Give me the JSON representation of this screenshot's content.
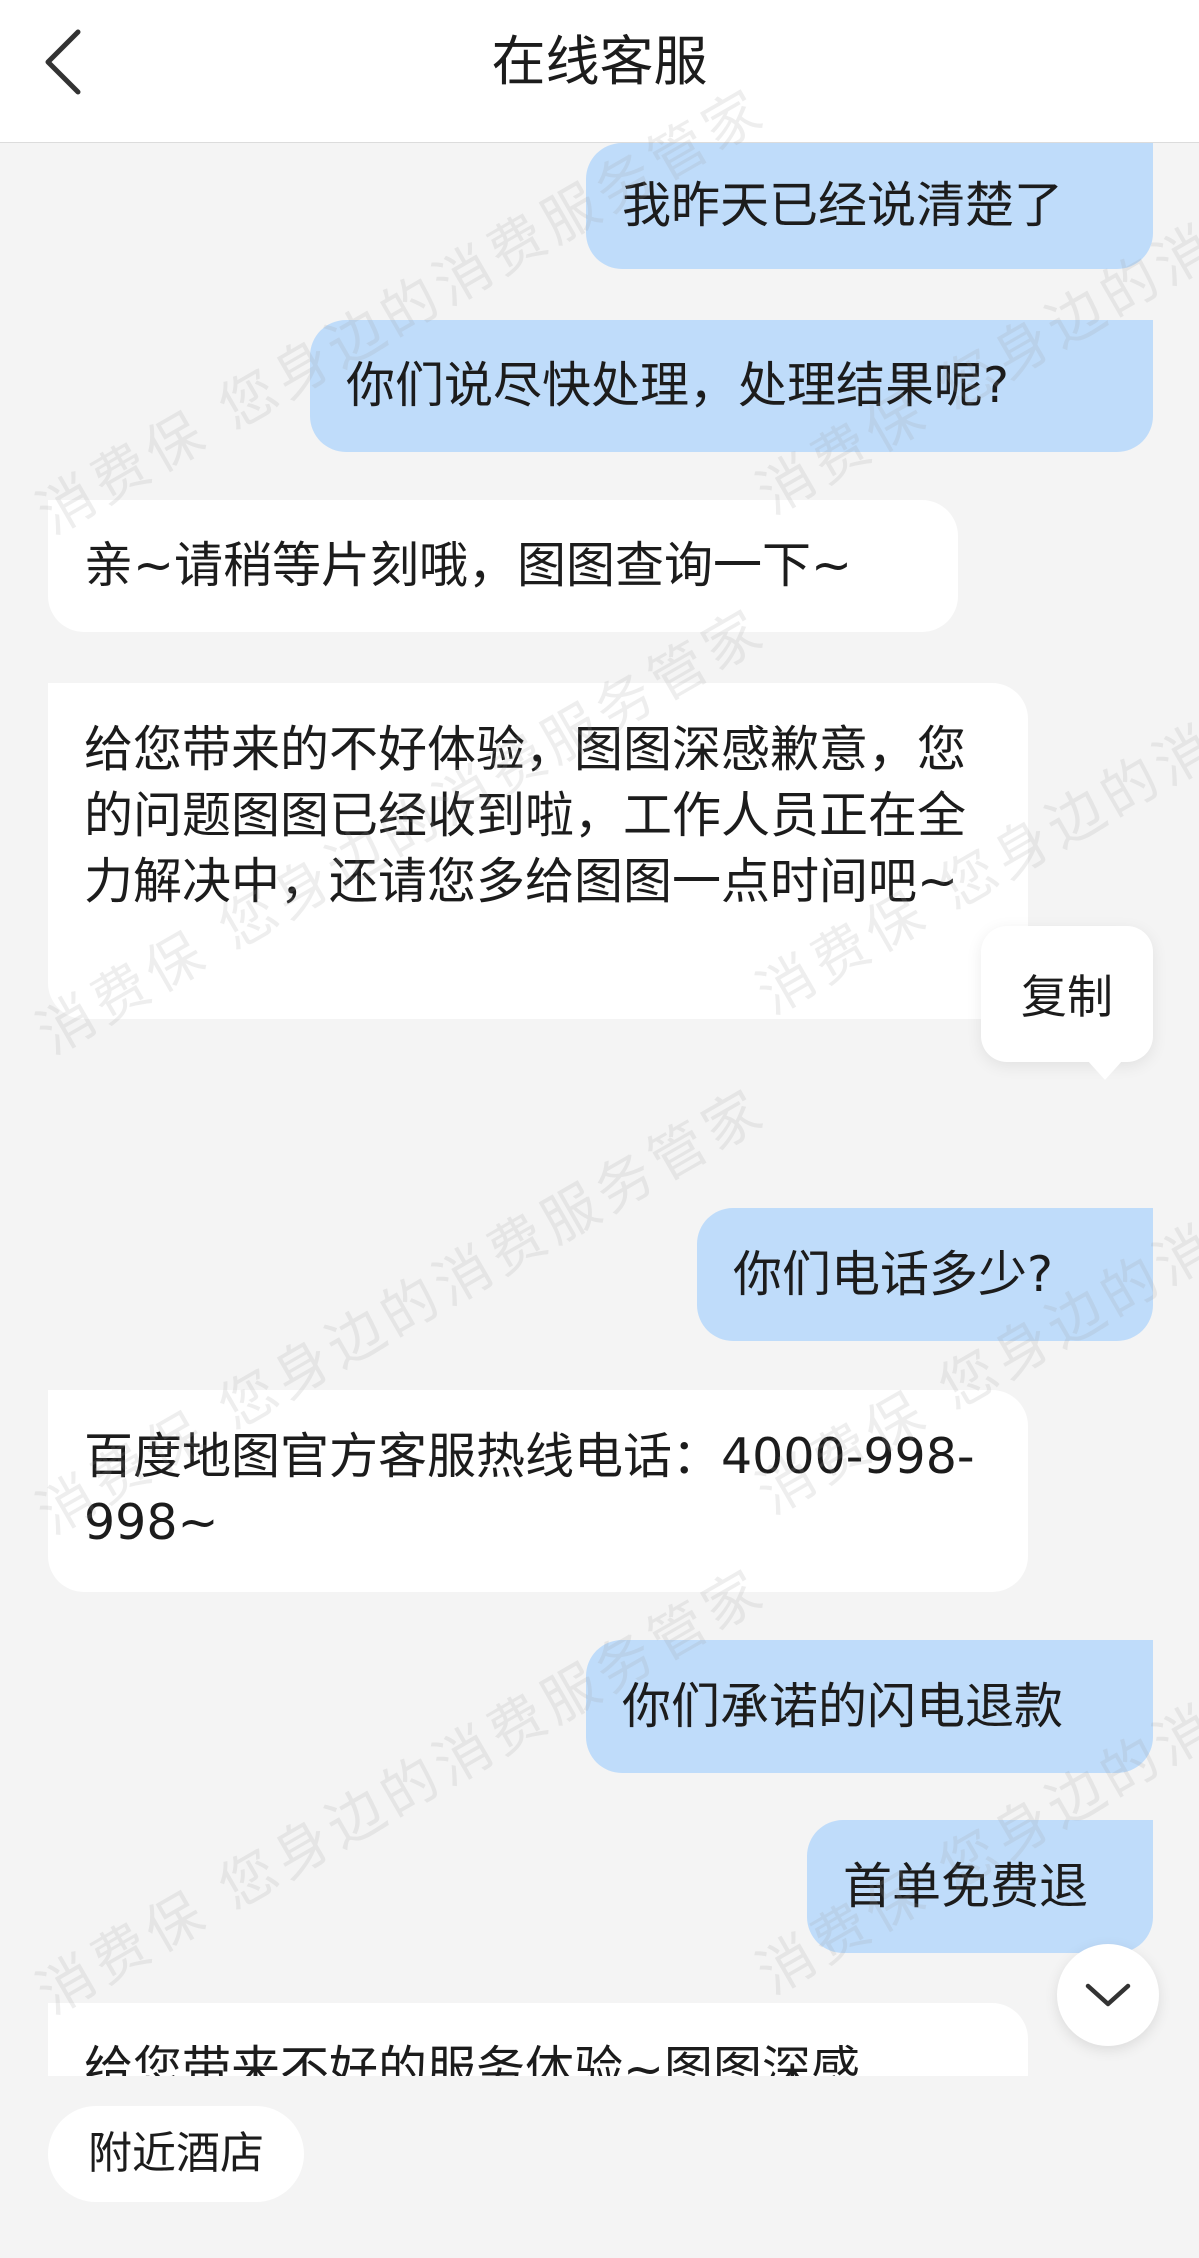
{
  "header": {
    "title": "在线客服",
    "back_icon": "chevron-left-icon"
  },
  "messages": [
    {
      "side": "right",
      "text": "我昨天已经说清楚了"
    },
    {
      "side": "right",
      "text": "你们说尽快处理，处理结果呢?"
    },
    {
      "side": "left",
      "text": "亲~请稍等片刻哦，图图查询一下~"
    },
    {
      "side": "left",
      "text": "给您带来的不好体验，图图深感歉意，您的问题图图已经收到啦，工作人员正在全力解决中，还请您多给图图一点时间吧~"
    },
    {
      "side": "right",
      "text": "你们电话多少?"
    },
    {
      "side": "left",
      "text": "百度地图官方客服热线电话：4000-998-998~"
    },
    {
      "side": "right",
      "text": "你们承诺的闪电退款"
    },
    {
      "side": "right",
      "text": "首单免费退"
    },
    {
      "side": "left",
      "text": "给您带来不好的服务体验~图图深感"
    }
  ],
  "copy_popup": {
    "label": "复制"
  },
  "scroll_down": {
    "icon": "chevron-down-icon"
  },
  "bottom": {
    "chip_label": "附近酒店"
  },
  "watermark": {
    "text": "消费保 您身边的消费服务管家"
  },
  "colors": {
    "user_bubble": "#bfdcfa",
    "agent_bubble": "#ffffff",
    "background": "#f4f4f4"
  }
}
